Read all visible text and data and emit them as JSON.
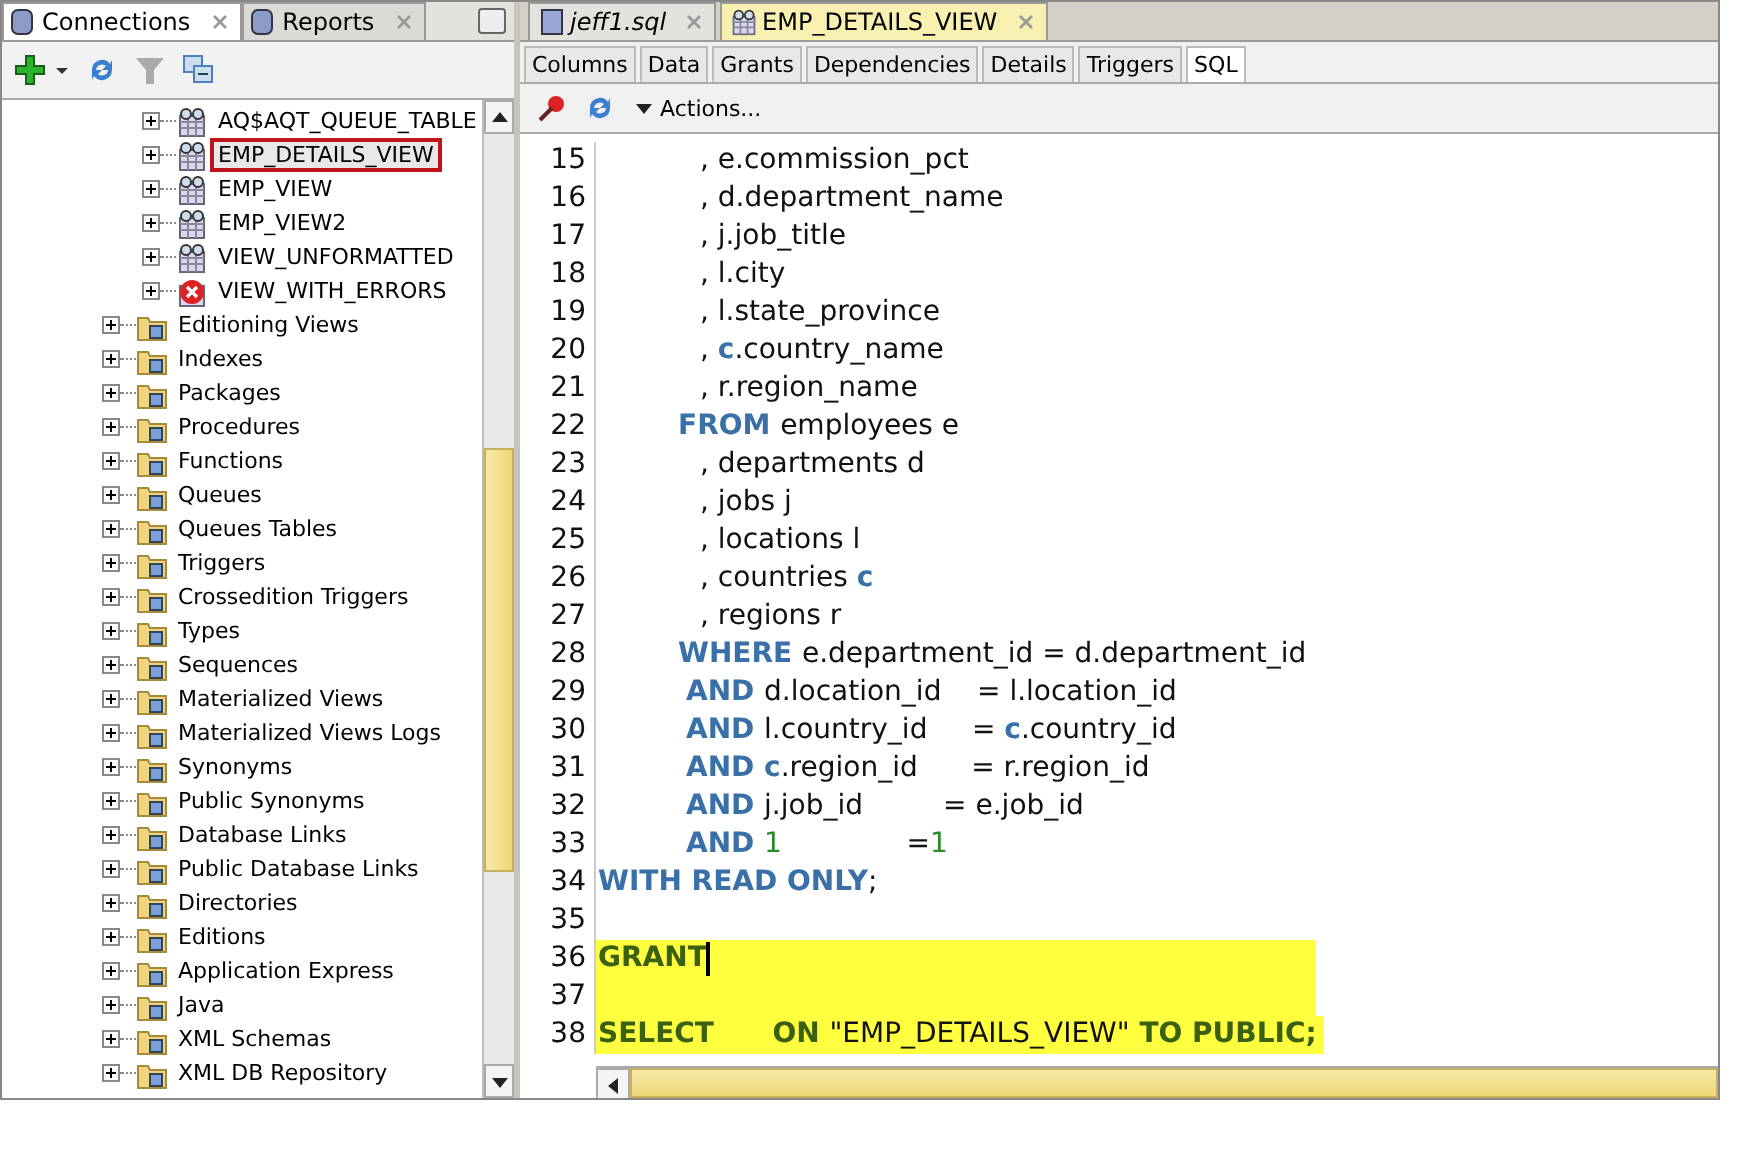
{
  "left_tabs": [
    {
      "label": "Connections",
      "selected": true
    },
    {
      "label": "Reports",
      "selected": false
    }
  ],
  "tree": {
    "views": [
      {
        "label": "AQ$AQT_QUEUE_TABLE",
        "kind": "view",
        "highlighted": false
      },
      {
        "label": "EMP_DETAILS_VIEW",
        "kind": "view",
        "highlighted": true
      },
      {
        "label": "EMP_VIEW",
        "kind": "view",
        "highlighted": false
      },
      {
        "label": "EMP_VIEW2",
        "kind": "view",
        "highlighted": false
      },
      {
        "label": "VIEW_UNFORMATTED",
        "kind": "view",
        "highlighted": false
      },
      {
        "label": "VIEW_WITH_ERRORS",
        "kind": "error",
        "highlighted": false
      }
    ],
    "folders": [
      {
        "label": "Editioning Views"
      },
      {
        "label": "Indexes"
      },
      {
        "label": "Packages"
      },
      {
        "label": "Procedures"
      },
      {
        "label": "Functions"
      },
      {
        "label": "Queues"
      },
      {
        "label": "Queues Tables"
      },
      {
        "label": "Triggers"
      },
      {
        "label": "Crossedition Triggers"
      },
      {
        "label": "Types"
      },
      {
        "label": "Sequences"
      },
      {
        "label": "Materialized Views"
      },
      {
        "label": "Materialized Views Logs"
      },
      {
        "label": "Synonyms"
      },
      {
        "label": "Public Synonyms"
      },
      {
        "label": "Database Links"
      },
      {
        "label": "Public Database Links"
      },
      {
        "label": "Directories"
      },
      {
        "label": "Editions"
      },
      {
        "label": "Application Express"
      },
      {
        "label": "Java"
      },
      {
        "label": "XML Schemas"
      },
      {
        "label": "XML DB Repository"
      }
    ]
  },
  "editor_tabs": [
    {
      "label": "jeff1.sql",
      "selected": false,
      "modified": true
    },
    {
      "label": "EMP_DETAILS_VIEW",
      "selected": true,
      "modified": false
    }
  ],
  "sub_tabs": [
    {
      "label": "Columns",
      "selected": false
    },
    {
      "label": "Data",
      "selected": false
    },
    {
      "label": "Grants",
      "selected": false
    },
    {
      "label": "Dependencies",
      "selected": false
    },
    {
      "label": "Details",
      "selected": false
    },
    {
      "label": "Triggers",
      "selected": false
    },
    {
      "label": "SQL",
      "selected": true
    }
  ],
  "actions_label": "Actions...",
  "code": [
    {
      "num": "15",
      "highlighted": false,
      "kind": "item",
      "segments": [
        {
          "kind": "plain",
          "text": ", e.commission_pct"
        }
      ]
    },
    {
      "num": "16",
      "highlighted": false,
      "kind": "item",
      "segments": [
        {
          "kind": "plain",
          "text": ", d.department_name"
        }
      ]
    },
    {
      "num": "17",
      "highlighted": false,
      "kind": "item",
      "segments": [
        {
          "kind": "plain",
          "text": ", j.job_title"
        }
      ]
    },
    {
      "num": "18",
      "highlighted": false,
      "kind": "item",
      "segments": [
        {
          "kind": "plain",
          "text": ", l.city"
        }
      ]
    },
    {
      "num": "19",
      "highlighted": false,
      "kind": "item",
      "segments": [
        {
          "kind": "plain",
          "text": ", l.state_province"
        }
      ]
    },
    {
      "num": "20",
      "highlighted": false,
      "kind": "item",
      "segments": [
        {
          "kind": "plain",
          "text": ", "
        },
        {
          "kind": "keyword",
          "text": "c"
        },
        {
          "kind": "plain",
          "text": ".country_name"
        }
      ]
    },
    {
      "num": "21",
      "highlighted": false,
      "kind": "item",
      "segments": [
        {
          "kind": "plain",
          "text": ", r.region_name"
        }
      ]
    },
    {
      "num": "22",
      "highlighted": false,
      "kind": "clause",
      "segments": [
        {
          "kind": "keyword",
          "text": "FROM "
        },
        {
          "kind": "plain",
          "text": "employees e"
        }
      ]
    },
    {
      "num": "23",
      "highlighted": false,
      "kind": "item",
      "segments": [
        {
          "kind": "plain",
          "text": ", departments d"
        }
      ]
    },
    {
      "num": "24",
      "highlighted": false,
      "kind": "item",
      "segments": [
        {
          "kind": "plain",
          "text": ", jobs j"
        }
      ]
    },
    {
      "num": "25",
      "highlighted": false,
      "kind": "item",
      "segments": [
        {
          "kind": "plain",
          "text": ", locations l"
        }
      ]
    },
    {
      "num": "26",
      "highlighted": false,
      "kind": "item",
      "segments": [
        {
          "kind": "plain",
          "text": ", countries "
        },
        {
          "kind": "keyword",
          "text": "c"
        }
      ]
    },
    {
      "num": "27",
      "highlighted": false,
      "kind": "item",
      "segments": [
        {
          "kind": "plain",
          "text": ", regions r"
        }
      ]
    },
    {
      "num": "28",
      "highlighted": false,
      "kind": "clause",
      "segments": [
        {
          "kind": "keyword",
          "text": "WHERE "
        },
        {
          "kind": "plain",
          "text": "e.department_id = d.department_id"
        }
      ]
    },
    {
      "num": "29",
      "highlighted": false,
      "kind": "condition",
      "segments": [
        {
          "kind": "keyword",
          "text": "AND "
        },
        {
          "kind": "plain",
          "text": "d.location_id    = l.location_id"
        }
      ]
    },
    {
      "num": "30",
      "highlighted": false,
      "kind": "condition",
      "segments": [
        {
          "kind": "keyword",
          "text": "AND "
        },
        {
          "kind": "plain",
          "text": "l.country_id     = "
        },
        {
          "kind": "keyword",
          "text": "c"
        },
        {
          "kind": "plain",
          "text": ".country_id"
        }
      ]
    },
    {
      "num": "31",
      "highlighted": false,
      "kind": "condition",
      "segments": [
        {
          "kind": "keyword",
          "text": "AND "
        },
        {
          "kind": "keyword",
          "text": "c"
        },
        {
          "kind": "plain",
          "text": ".region_id      = r.region_id"
        }
      ]
    },
    {
      "num": "32",
      "highlighted": false,
      "kind": "condition",
      "segments": [
        {
          "kind": "keyword",
          "text": "AND "
        },
        {
          "kind": "plain",
          "text": "j.job_id         = e.job_id"
        }
      ]
    },
    {
      "num": "33",
      "highlighted": false,
      "kind": "condition",
      "segments": [
        {
          "kind": "keyword",
          "text": "AND "
        },
        {
          "kind": "number",
          "text": "1"
        },
        {
          "kind": "plain",
          "text": "              ="
        },
        {
          "kind": "number",
          "text": "1"
        }
      ]
    },
    {
      "num": "34",
      "highlighted": false,
      "kind": "plain",
      "segments": [
        {
          "kind": "keyword",
          "text": "WITH READ ONLY"
        },
        {
          "kind": "plain",
          "text": ";"
        }
      ]
    },
    {
      "num": "35",
      "highlighted": false,
      "kind": "plain"
    },
    {
      "num": "36",
      "highlighted": true,
      "cursor": true,
      "kind": "plain",
      "segments": [
        {
          "kind": "grant",
          "text": "GRANT"
        }
      ]
    },
    {
      "num": "37",
      "highlighted": true,
      "kind": "plain"
    },
    {
      "num": "38",
      "highlighted": true,
      "kind": "plain",
      "segments": [
        {
          "kind": "grant",
          "text": "SELECT      ON "
        },
        {
          "kind": "plain",
          "text": "\"EMP_DETAILS_VIEW\""
        },
        {
          "kind": "grant",
          "text": " TO PUBLIC;"
        }
      ]
    }
  ]
}
